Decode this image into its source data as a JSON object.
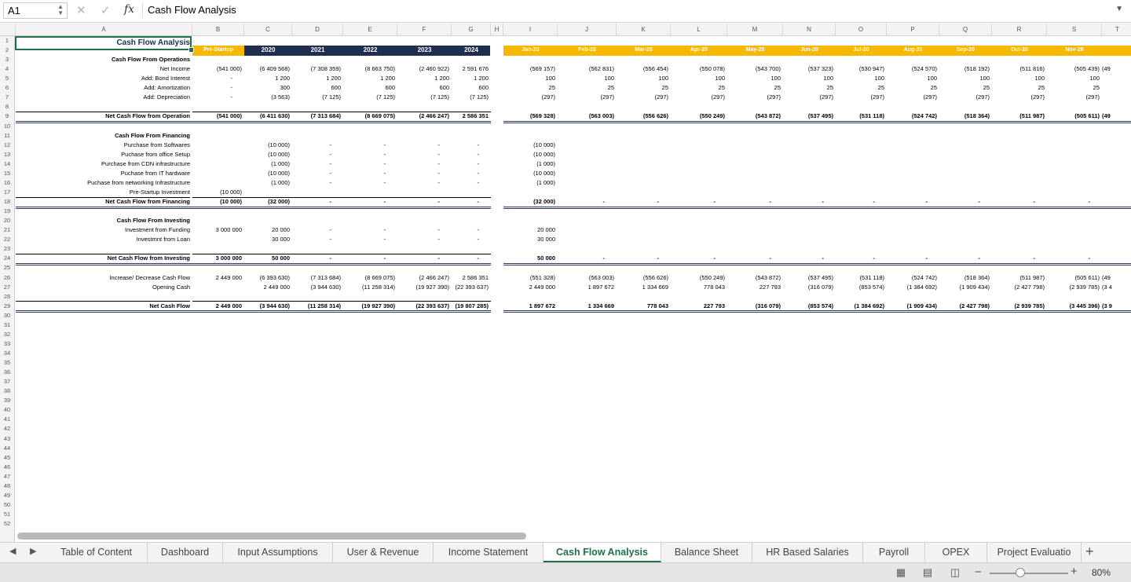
{
  "formula_bar": {
    "name_box": "A1",
    "formula": "Cash Flow Analysis"
  },
  "columns": [
    "A",
    "B",
    "C",
    "D",
    "E",
    "F",
    "G",
    "H",
    "I",
    "J",
    "K",
    "L",
    "M",
    "N",
    "O",
    "P",
    "Q",
    "R",
    "S",
    "T"
  ],
  "rows_visible": [
    "1",
    "2",
    "3",
    "4",
    "5",
    "6",
    "7",
    "8",
    "9",
    "10",
    "11",
    "12",
    "13",
    "14",
    "15",
    "16",
    "17",
    "18",
    "19",
    "20",
    "21",
    "22",
    "23",
    "24",
    "25",
    "26",
    "27",
    "28",
    "29",
    "30",
    "31",
    "32",
    "33",
    "34",
    "35",
    "36",
    "37",
    "38",
    "39",
    "40",
    "41",
    "42",
    "43",
    "44",
    "45",
    "46",
    "47",
    "48",
    "49",
    "50",
    "51",
    "52"
  ],
  "title": "Cash Flow Analysis",
  "annual_headers": [
    "Pre-Startup",
    "2020",
    "2021",
    "2022",
    "2023",
    "2024"
  ],
  "monthly_headers": [
    "Jan-20",
    "Feb-20",
    "Mar-20",
    "Apr-20",
    "May-20",
    "Jun-20",
    "Jul-20",
    "Aug-20",
    "Sep-20",
    "Oct-20",
    "Nov-20"
  ],
  "sheet_rows": [
    {
      "row": 3,
      "label": "Cash Flow From Operations",
      "bold": true,
      "annual": [],
      "monthly": []
    },
    {
      "row": 4,
      "label": "Net Income",
      "annual": [
        "(541 000)",
        "(6 409 568)",
        "(7 308 359)",
        "(8 663 750)",
        "(2 460 922)",
        "2 591 676"
      ],
      "monthly": [
        "(569 157)",
        "(562 831)",
        "(556 454)",
        "(550 078)",
        "(543 700)",
        "(537 323)",
        "(530 947)",
        "(524 570)",
        "(518 192)",
        "(511 816)",
        "(505 439)",
        "(49"
      ]
    },
    {
      "row": 5,
      "label": "Add: Bond Interest",
      "annual": [
        "-",
        "1 200",
        "1 200",
        "1 200",
        "1 200",
        "1 200"
      ],
      "monthly": [
        "100",
        "100",
        "100",
        "100",
        "100",
        "100",
        "100",
        "100",
        "100",
        "100",
        "100",
        ""
      ]
    },
    {
      "row": 6,
      "label": "Add: Amortization",
      "annual": [
        "-",
        "300",
        "600",
        "600",
        "600",
        "600"
      ],
      "monthly": [
        "25",
        "25",
        "25",
        "25",
        "25",
        "25",
        "25",
        "25",
        "25",
        "25",
        "25",
        ""
      ]
    },
    {
      "row": 7,
      "label": "Add: Depreciation",
      "annual": [
        "-",
        "(3 563)",
        "(7 125)",
        "(7 125)",
        "(7 125)",
        "(7 125)"
      ],
      "monthly": [
        "(297)",
        "(297)",
        "(297)",
        "(297)",
        "(297)",
        "(297)",
        "(297)",
        "(297)",
        "(297)",
        "(297)",
        "(297)",
        ""
      ]
    },
    {
      "row": 9,
      "label": "Net Cash Flow from Operation",
      "bold": true,
      "annual": [
        "(541 000)",
        "(6 411 630)",
        "(7 313 684)",
        "(8 669 075)",
        "(2 466 247)",
        "2 586 351"
      ],
      "monthly": [
        "(569 328)",
        "(563 003)",
        "(556 626)",
        "(550 249)",
        "(543 872)",
        "(537 495)",
        "(531 118)",
        "(524 742)",
        "(518 364)",
        "(511 987)",
        "(505 611)",
        "(49"
      ]
    },
    {
      "row": 11,
      "label": "Cash Flow From Financing",
      "bold": true,
      "annual": [],
      "monthly": []
    },
    {
      "row": 12,
      "label": "Purchase from Softwares",
      "annual": [
        "",
        "(10 000)",
        "-",
        "-",
        "-",
        "-"
      ],
      "monthly": [
        "(10 000)"
      ]
    },
    {
      "row": 13,
      "label": "Puchase from office Setup",
      "annual": [
        "",
        "(10 000)",
        "-",
        "-",
        "-",
        "-"
      ],
      "monthly": [
        "(10 000)"
      ]
    },
    {
      "row": 14,
      "label": "Purchase from CDN infrastructure",
      "annual": [
        "",
        "(1 000)",
        "-",
        "-",
        "-",
        "-"
      ],
      "monthly": [
        "(1 000)"
      ]
    },
    {
      "row": 15,
      "label": "Puchase from IT hardware",
      "annual": [
        "",
        "(10 000)",
        "-",
        "-",
        "-",
        "-"
      ],
      "monthly": [
        "(10 000)"
      ]
    },
    {
      "row": 16,
      "label": "Puchase from networking Infrastructure",
      "annual": [
        "",
        "(1 000)",
        "-",
        "-",
        "-",
        "-"
      ],
      "monthly": [
        "(1 000)"
      ]
    },
    {
      "row": 17,
      "label": "Pre-Startup Investment",
      "annual": [
        "(10 000)"
      ],
      "monthly": []
    },
    {
      "row": 18,
      "label": "Net Cash Flow from Financing",
      "bold": true,
      "annual": [
        "(10 000)",
        "(32 000)",
        "-",
        "-",
        "-",
        "-"
      ],
      "monthly": [
        "(32 000)",
        "-",
        "-",
        "-",
        "-",
        "-",
        "-",
        "-",
        "-",
        "-",
        "-",
        ""
      ]
    },
    {
      "row": 20,
      "label": "Cash Flow From Investing",
      "bold": true,
      "annual": [],
      "monthly": []
    },
    {
      "row": 21,
      "label": "Investment from Funding",
      "annual": [
        "3 000 000",
        "20 000",
        "-",
        "-",
        "-",
        "-"
      ],
      "monthly": [
        "20 000"
      ]
    },
    {
      "row": 22,
      "label": "Investmnt from Loan",
      "annual": [
        "",
        "30 000",
        "-",
        "-",
        "-",
        "-"
      ],
      "monthly": [
        "30 000"
      ]
    },
    {
      "row": 24,
      "label": "Net Cash Flow from Investing",
      "bold": true,
      "annual": [
        "3 000 000",
        "50 000",
        "-",
        "-",
        "-",
        "-"
      ],
      "monthly": [
        "50 000",
        "-",
        "-",
        "-",
        "-",
        "-",
        "-",
        "-",
        "-",
        "-",
        "-",
        ""
      ]
    },
    {
      "row": 26,
      "label": "Increase/ Decrease Cash Flow",
      "annual": [
        "2 449 000",
        "(6 393 630)",
        "(7 313 684)",
        "(8 669 075)",
        "(2 466 247)",
        "2 586 351"
      ],
      "monthly": [
        "(551 328)",
        "(563 003)",
        "(556 626)",
        "(550 249)",
        "(543 872)",
        "(537 495)",
        "(531 118)",
        "(524 742)",
        "(518 364)",
        "(511 987)",
        "(505 611)",
        "(49"
      ]
    },
    {
      "row": 27,
      "label": "Opening Cash",
      "annual": [
        "",
        "2 449 000",
        "(3 944 630)",
        "(11 258 314)",
        "(19 927 390)",
        "(22 393 637)"
      ],
      "monthly": [
        "2 449 000",
        "1 897 672",
        "1 334 669",
        "778 043",
        "227 793",
        "(316 079)",
        "(853 574)",
        "(1 384 692)",
        "(1 909 434)",
        "(2 427 798)",
        "(2 939 785)",
        "(3 4"
      ]
    },
    {
      "row": 29,
      "label": "Net Cash Flow",
      "bold": true,
      "annual": [
        "2 449 000",
        "(3 944 630)",
        "(11 258 314)",
        "(19 927 390)",
        "(22 393 637)",
        "(19 807 285)"
      ],
      "monthly": [
        "1 897 672",
        "1 334 669",
        "778 043",
        "227 793",
        "(316 079)",
        "(853 574)",
        "(1 384 692)",
        "(1 909 434)",
        "(2 427 798)",
        "(2 939 785)",
        "(3 445 396)",
        "(3 9"
      ]
    }
  ],
  "tabs": [
    "Table of Content",
    "Dashboard",
    "Input Assumptions",
    "User & Revenue",
    "Income Statement",
    "Cash Flow Analysis",
    "Balance Sheet",
    "HR Based Salaries",
    "Payroll",
    "OPEX",
    "Project Evaluatio"
  ],
  "active_tab": "Cash Flow Analysis",
  "zoom": "80%",
  "colors": {
    "navy": "#1f2d4f",
    "gold": "#f8b800",
    "excel_green": "#1e7145"
  }
}
